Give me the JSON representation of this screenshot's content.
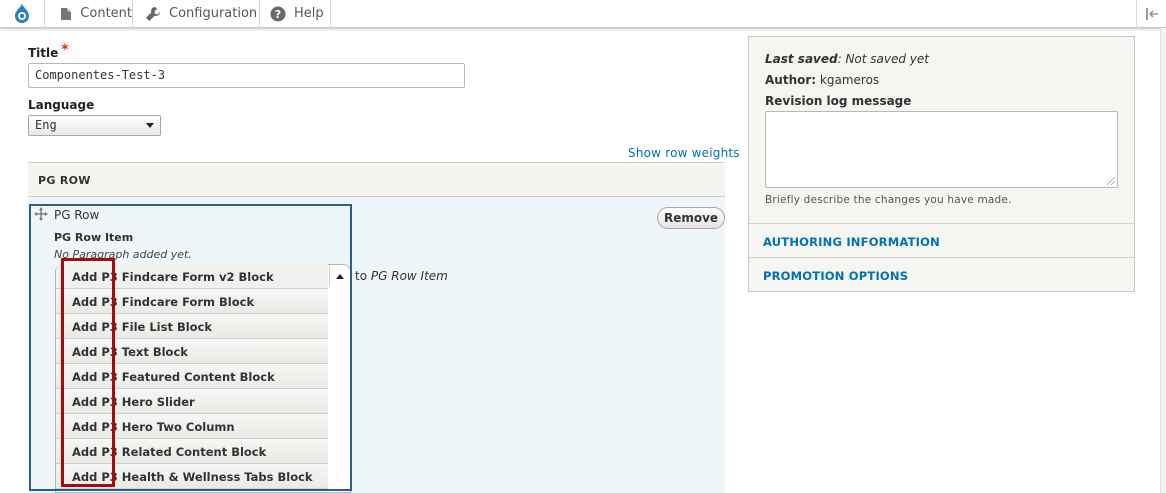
{
  "toolbar": {
    "logo_icon": "drupal-drop-icon",
    "items": [
      {
        "label": "Content",
        "icon": "page-icon"
      },
      {
        "label": "Configuration",
        "icon": "wrench-icon"
      },
      {
        "label": "Help",
        "icon": "help-icon"
      }
    ],
    "collapse_icon": "sidebar-collapse-icon"
  },
  "form": {
    "title_label": "Title",
    "required_mark": "*",
    "title_value": "Componentes-Test-3",
    "language_label": "Language",
    "language_value": "Eng",
    "show_row_weights": "Show row weights",
    "pg_row_header": "PG ROW",
    "pg_row_label": "PG Row",
    "remove_label": "Remove",
    "pg_row_item_label": "PG Row Item",
    "no_paragraph": "No Paragraph added yet.",
    "to_prefix": "to",
    "to_target": "PG Row Item",
    "add_buttons": [
      "Add P3 Findcare Form v2 Block",
      "Add P3 Findcare Form Block",
      "Add P3 File List Block",
      "Add P3 Text Block",
      "Add P3 Featured Content Block",
      "Add P3 Hero Slider",
      "Add P3 Hero Two Column",
      "Add P3 Related Content Block",
      "Add P3 Health & Wellness Tabs Block"
    ]
  },
  "sidebar": {
    "last_saved_label": "Last saved",
    "last_saved_value": ": Not saved yet",
    "author_label": "Author:",
    "author_value": "kgameros",
    "revision_label": "Revision log message",
    "revision_desc": "Briefly describe the changes you have made.",
    "sections": [
      "AUTHORING INFORMATION",
      "PROMOTION OPTIONS"
    ]
  },
  "colors": {
    "link": "#0071b3",
    "annotation_blue": "#2d5d8e",
    "annotation_red": "#a50d0d",
    "required": "#e62600"
  }
}
